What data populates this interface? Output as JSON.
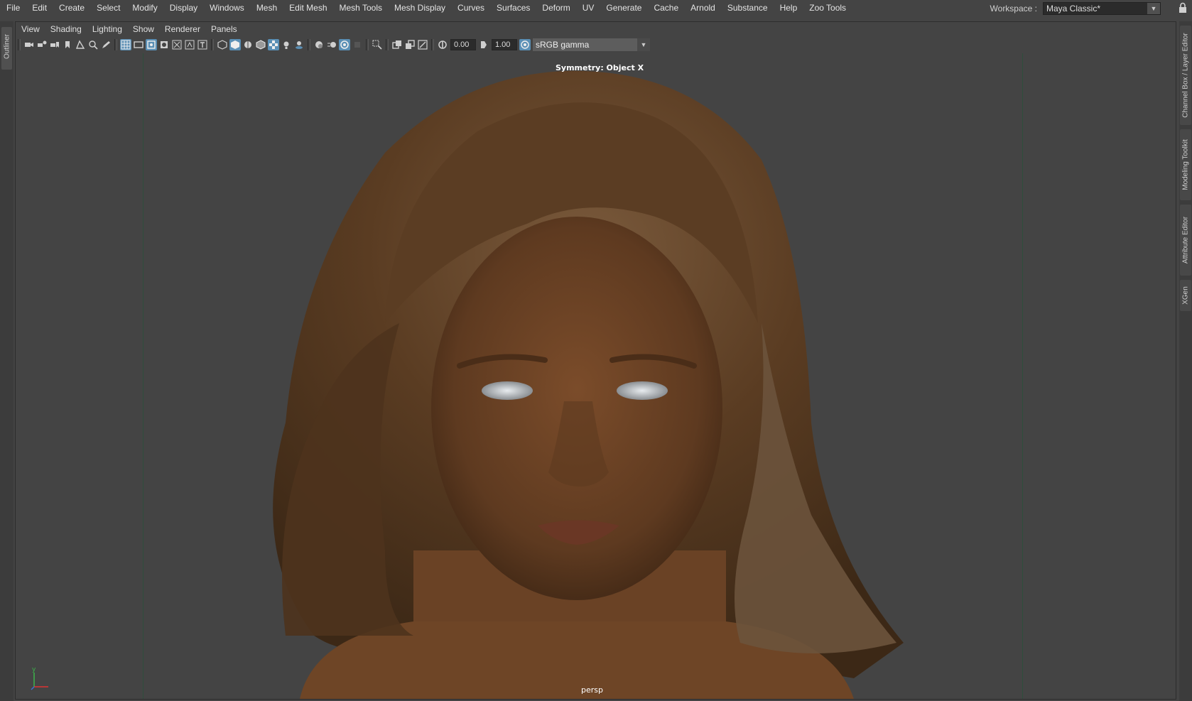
{
  "menubar": {
    "items": [
      "File",
      "Edit",
      "Create",
      "Select",
      "Modify",
      "Display",
      "Windows",
      "Mesh",
      "Edit Mesh",
      "Mesh Tools",
      "Mesh Display",
      "Curves",
      "Surfaces",
      "Deform",
      "UV",
      "Generate",
      "Cache",
      "Arnold",
      "Substance",
      "Help",
      "Zoo Tools"
    ]
  },
  "workspace": {
    "label": "Workspace :",
    "value": "Maya Classic*"
  },
  "left_tabs": {
    "outliner": "Outliner"
  },
  "right_tabs": {
    "channel_box": "Channel Box / Layer Editor",
    "modeling_toolkit": "Modeling Toolkit",
    "attribute_editor": "Attribute Editor",
    "xgen": "XGen"
  },
  "panel_menu": {
    "items": [
      "View",
      "Shading",
      "Lighting",
      "Show",
      "Renderer",
      "Panels"
    ]
  },
  "toolbar": {
    "exposure": "0.00",
    "gamma": "1.00",
    "color_management": "sRGB gamma"
  },
  "viewport": {
    "symmetry": "Symmetry: Object X",
    "camera": "persp",
    "axis_y": "y"
  },
  "colors": {
    "accent": "#5a8fb5",
    "skin": "#6a4225",
    "hair": "#5e3f24",
    "gate": "#2f4e3c"
  }
}
